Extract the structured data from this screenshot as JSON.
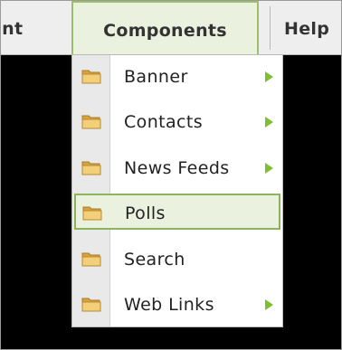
{
  "menubar": {
    "items": [
      {
        "label": "ent"
      },
      {
        "label": "Components"
      },
      {
        "label": "Help"
      }
    ]
  },
  "dropdown": {
    "items": [
      {
        "label": "Banner",
        "icon": "folder-icon",
        "submenu": true
      },
      {
        "label": "Contacts",
        "icon": "folder-icon",
        "submenu": true
      },
      {
        "label": "News Feeds",
        "icon": "folder-icon",
        "submenu": true
      },
      {
        "label": "Polls",
        "icon": "folder-icon",
        "submenu": false,
        "highlighted": true
      },
      {
        "label": "Search",
        "icon": "folder-icon",
        "submenu": false
      },
      {
        "label": "Web Links",
        "icon": "folder-icon",
        "submenu": true
      }
    ]
  },
  "colors": {
    "accent": "#8cb45a",
    "arrow": "#7cc02f",
    "menubar": "#eeeeee",
    "highlight": "#ebf1df"
  }
}
